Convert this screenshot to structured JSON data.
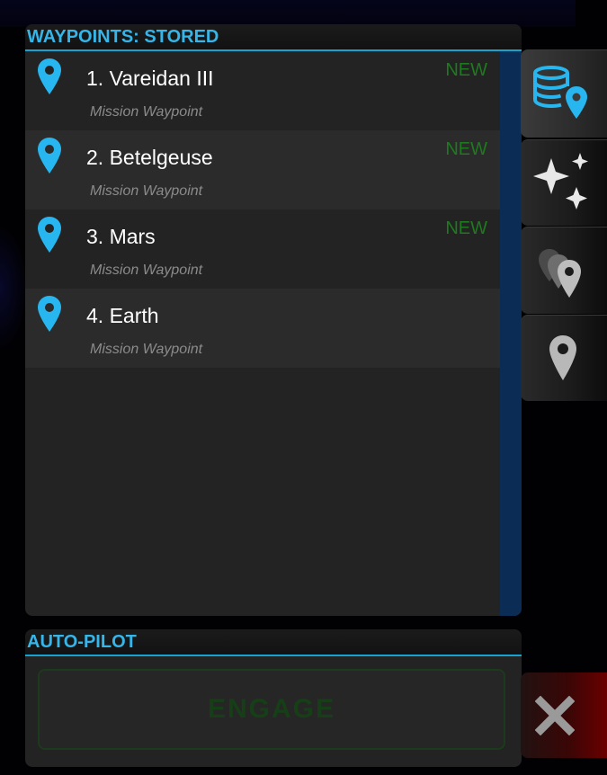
{
  "waypoints_panel": {
    "title": "WAYPOINTS: STORED",
    "items": [
      {
        "name": "1. Vareidan III",
        "type": "Mission Waypoint",
        "badge": "NEW"
      },
      {
        "name": "2. Betelgeuse",
        "type": "Mission Waypoint",
        "badge": "NEW"
      },
      {
        "name": "3. Mars",
        "type": "Mission Waypoint",
        "badge": "NEW"
      },
      {
        "name": "4. Earth",
        "type": "Mission Waypoint",
        "badge": ""
      }
    ]
  },
  "tabs": [
    {
      "icon": "database-pin-icon",
      "active": true
    },
    {
      "icon": "sparkles-icon",
      "active": false
    },
    {
      "icon": "multiple-pins-icon",
      "active": false
    },
    {
      "icon": "map-pin-icon",
      "active": false
    }
  ],
  "autopilot": {
    "title": "AUTO-PILOT",
    "engage_label": "ENGAGE"
  },
  "close_button": {
    "icon": "close-icon"
  },
  "colors": {
    "accent_blue": "#36b5e8",
    "pin_blue": "#27b6ef",
    "new_badge_green": "#1e7a1e",
    "engage_text": "#173f17",
    "scroll_track": "#0b2d55",
    "close_red": "#6a0000"
  }
}
